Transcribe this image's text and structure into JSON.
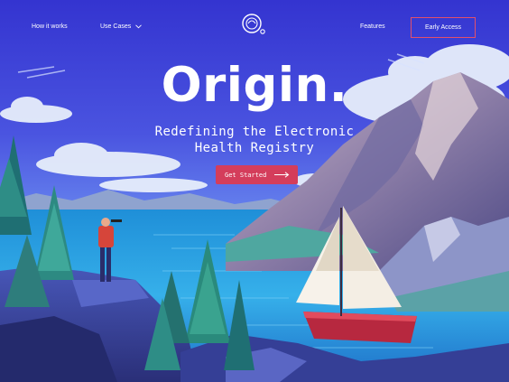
{
  "nav": {
    "how_it_works": "How it works",
    "use_cases": "Use Cases",
    "features": "Features",
    "early_access": "Early Access"
  },
  "hero": {
    "title": "Origin.",
    "subtitle_line1": "Redefining the Electronic",
    "subtitle_line2": "Health Registry",
    "cta_label": "Get Started"
  },
  "colors": {
    "sky": "#3f3fd4",
    "accent": "#d43d5b",
    "water": "#3aa7e6"
  },
  "icons": {
    "logo": "origin-logo-icon",
    "chevron": "chevron-down-icon",
    "arrow": "arrow-right-icon"
  }
}
